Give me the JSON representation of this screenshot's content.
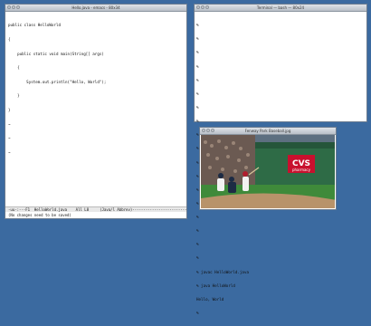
{
  "emacs": {
    "title": "Hello.java - emacs - 80x34",
    "lines": [
      "public class HelloWorld",
      "{",
      "    public static void main(String[] args)",
      "    {",
      "        System.out.println(\"Hello, World\");",
      "    }",
      "}",
      "~",
      "~",
      "~"
    ],
    "modeline": "-uu-:---F1  HelloWorld.java    All L8     (Java/l Abbrev)-------------------------",
    "minibuffer": "(No changes need to be saved)"
  },
  "terminal": {
    "title": "Terminal — bash — 80x24",
    "lines": [
      "%",
      "%",
      "%",
      "%",
      "%",
      "%",
      "%",
      "%",
      "%",
      "%",
      "%",
      "%",
      "%",
      "%",
      "%",
      "%",
      "%",
      "%",
      "% javac HelloWorld.java",
      "% java HelloWorld",
      "Hello, World",
      "%"
    ]
  },
  "photo_window": {
    "title": "Fenway Park Baseball.jpg",
    "sign_text": "CVS",
    "sign_sub": "pharmacy"
  },
  "colors": {
    "desktop": "#3b6aa0",
    "grass": "#3f8a3a",
    "wall": "#2e6b46"
  }
}
